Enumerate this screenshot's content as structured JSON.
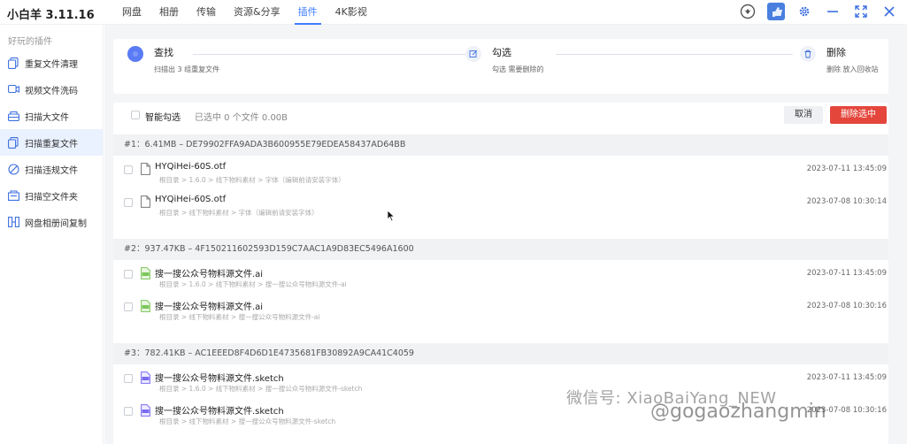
{
  "app": {
    "title": "小白羊 3.11.16"
  },
  "nav": {
    "items": [
      "网盘",
      "相册",
      "传输",
      "资源&分享",
      "插件",
      "4K影视"
    ],
    "active_index": 4
  },
  "top_icons": [
    "crown-badge-icon",
    "avatar",
    "gear-icon",
    "minimize-icon",
    "fullscreen-icon",
    "close-icon"
  ],
  "sidebar": {
    "title": "好玩的插件",
    "active_index": 3,
    "items": [
      {
        "label": "重复文件清理",
        "icon": "copy-icon"
      },
      {
        "label": "视频文件洗码",
        "icon": "video-icon"
      },
      {
        "label": "扫描大文件",
        "icon": "scan-icon"
      },
      {
        "label": "扫描重复文件",
        "icon": "copy-icon"
      },
      {
        "label": "扫描违规文件",
        "icon": "forbidden-icon"
      },
      {
        "label": "扫描空文件夹",
        "icon": "folder-scan-icon"
      },
      {
        "label": "网盘相册间复制",
        "icon": "transfer-icon"
      }
    ]
  },
  "steps": [
    {
      "title": "查找",
      "desc": "扫描出 3 组重复文件"
    },
    {
      "title": "勾选",
      "desc": "勾选 需要删除的"
    },
    {
      "title": "删除",
      "desc": "删除 放入回收站"
    }
  ],
  "toolbar": {
    "smart_select": "智能勾选",
    "selection_info": "已选中 0 个文件 0.00B",
    "cancel": "取消",
    "delete_selected": "删除选中"
  },
  "groups": [
    {
      "header": "#1：6.41MB – DE79902FFA9ADA3B600955E79EDEA58437AD64BB",
      "files": [
        {
          "name": "HYQiHei-60S.otf",
          "path": "根目录 > 1.6.0 > 线下物料素材 > 字体（编辑前请安装字体）",
          "date": "2023-07-11 13:45:09",
          "icon": "doc"
        },
        {
          "name": "HYQiHei-60S.otf",
          "path": "根目录 > 线下物料素材 > 字体（编辑前请安装字体）",
          "date": "2023-07-08 10:30:14",
          "icon": "doc"
        }
      ]
    },
    {
      "header": "#2：937.47KB – 4F150211602593D159C7AAC1A9D83EC5496A1600",
      "files": [
        {
          "name": "搜一搜公众号物料源文件.ai",
          "path": "根目录 > 1.6.0 > 线下物料素材 > 搜一搜公众号物料源文件-ai",
          "date": "2023-07-11 13:45:09",
          "icon": "ai"
        },
        {
          "name": "搜一搜公众号物料源文件.ai",
          "path": "根目录 > 线下物料素材 > 搜一搜公众号物料源文件-ai",
          "date": "2023-07-08 10:30:16",
          "icon": "ai"
        }
      ]
    },
    {
      "header": "#3：782.41KB – AC1EEED8F4D6D1E4735681FB30892A9CA41C4059",
      "files": [
        {
          "name": "搜一搜公众号物料源文件.sketch",
          "path": "根目录 > 1.6.0 > 线下物料素材 > 搜一搜公众号物料源文件-sketch",
          "date": "2023-07-11 13:45:09",
          "icon": "sketch"
        },
        {
          "name": "搜一搜公众号物料源文件.sketch",
          "path": "根目录 > 线下物料素材 > 搜一搜公众号物料源文件-sketch",
          "date": "2023-07-08 10:30:16",
          "icon": "sketch"
        }
      ]
    }
  ],
  "watermark": {
    "line1": "微信号: XiaoBaiYang_NEW",
    "line2": "@gogaozhangmin"
  },
  "colors": {
    "accent": "#3d7eff",
    "danger": "#e4463c",
    "step_active": "#5a7bf5",
    "ai_icon": "#7cc65a",
    "sketch_icon": "#7a6cf0"
  }
}
